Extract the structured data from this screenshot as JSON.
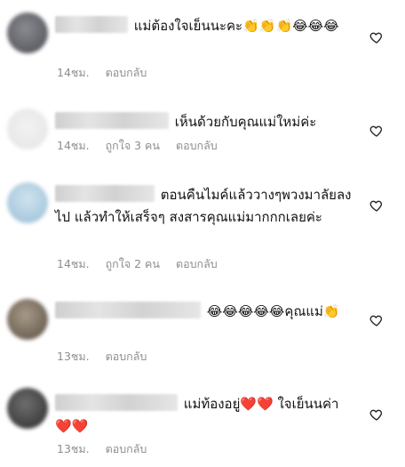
{
  "comments": [
    {
      "text": "แม่ต้องใจเย็นนะคะ👏👏👏😂😂😂",
      "time": "14ชม.",
      "likes": "",
      "reply": "ตอบกลับ"
    },
    {
      "text": "เห็นด้วยกับคุณแม่ใหม่ค่ะ",
      "time": "14ชม.",
      "likes": "ถูกใจ 3 คน",
      "reply": "ตอบกลับ"
    },
    {
      "text": "ตอนคืนไมค์แล้ววางๆพวงมาลัยลงไป แล้วทำให้เสร็จๆ สงสารคุณแม่มากกกเลยค่ะ",
      "time": "14ชม.",
      "likes": "ถูกใจ 2 คน",
      "reply": "ตอบกลับ"
    },
    {
      "text": "😂😂😂😂😂คุณแม่👏",
      "time": "13ชม.",
      "likes": "",
      "reply": "ตอบกลับ"
    },
    {
      "text": "แม่ท้องอยู่❤️❤️ ใจเย็นนค่า❤️❤️",
      "time": "13ชม.",
      "likes": "",
      "reply": "ตอบกลับ"
    }
  ],
  "icons": {
    "like": "heart-outline-icon"
  },
  "colors": {
    "meta": "#8e8e8e",
    "text": "#111111"
  }
}
